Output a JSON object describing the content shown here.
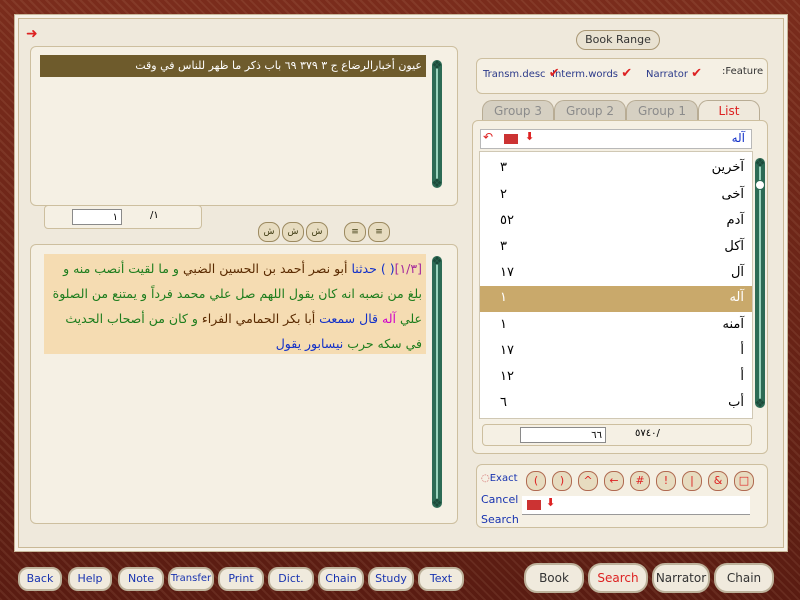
{
  "header": {
    "book_line": "عيون أخبارالرضاع   ج ٣  ٣٧٩  ٦٩ باب ذكر ما ظهر للناس في وقت"
  },
  "page_nav": {
    "current_page": "١",
    "total_pages": "/١"
  },
  "text_controls": [
    "ش",
    "ش",
    "ش",
    "≡",
    "≡"
  ],
  "hadith": {
    "ref": "[١/٣]",
    "brace": "( )",
    "l1_a": "حدثنا",
    "l1_b": "أبو نصر أحمد بن الحسين الضبي",
    "l1_c": "و ما لقيت أنصب منه",
    "l2": "و بلغ من نصبه انه كان يقول اللهم صل علي محمد فرداً و يمتنع من",
    "l3_a": "الصلوة علي",
    "l3_b": "آله",
    "l3_c": "قال",
    "l3_d": "سمعت",
    "l3_e": "أبا بكر الحمامي الفراء",
    "l3_f": "و كان من أصحاب",
    "l4_a": "الحديث في سكه حرب",
    "l4_b": "نيسابور يقول"
  },
  "right": {
    "book_range": "Book Range",
    "feature_label": ":Feature",
    "features": [
      {
        "label": "Narrator",
        "checked": true
      },
      {
        "label": "Interm.words",
        "checked": true
      },
      {
        "label": "Transm.desc",
        "checked": true
      }
    ],
    "tabs": [
      "Group 3",
      "Group 2",
      "Group 1",
      "List"
    ],
    "active_tab": "List",
    "search_word": "آله",
    "list": [
      {
        "word": "آخرين",
        "count": "٣"
      },
      {
        "word": "آخى",
        "count": "٢"
      },
      {
        "word": "آدم",
        "count": "٥٢"
      },
      {
        "word": "آكل",
        "count": "٣"
      },
      {
        "word": "آل",
        "count": "١٧"
      },
      {
        "word": "آله",
        "count": "١",
        "selected": true
      },
      {
        "word": "آمنه",
        "count": "١"
      },
      {
        "word": "أ",
        "count": "١٧"
      },
      {
        "word": "أ",
        "count": "١٢"
      },
      {
        "word": "أب",
        "count": "٦"
      }
    ],
    "list_position": "٦٦",
    "list_total": "/٥٧٤٠"
  },
  "search": {
    "exact": "Exact",
    "cancel": "Cancel",
    "search": "Search",
    "ops": [
      "(",
      ")",
      "^",
      "←",
      "#",
      "!",
      "|",
      "&",
      "□"
    ]
  },
  "bottom": {
    "left_buttons": [
      "Back",
      "Help",
      "Note",
      "Transfer",
      "Print",
      "Dict.",
      "Chain",
      "Study",
      "Text"
    ],
    "right_buttons": [
      "Book",
      "Search",
      "Narrator",
      "Chain"
    ],
    "active_right": "Search"
  },
  "colors": {
    "accent": "#dd2222",
    "selected_row": "#c9a96b",
    "header_bar": "#6e5b2c",
    "hadith_bg": "#f5dcb2"
  }
}
